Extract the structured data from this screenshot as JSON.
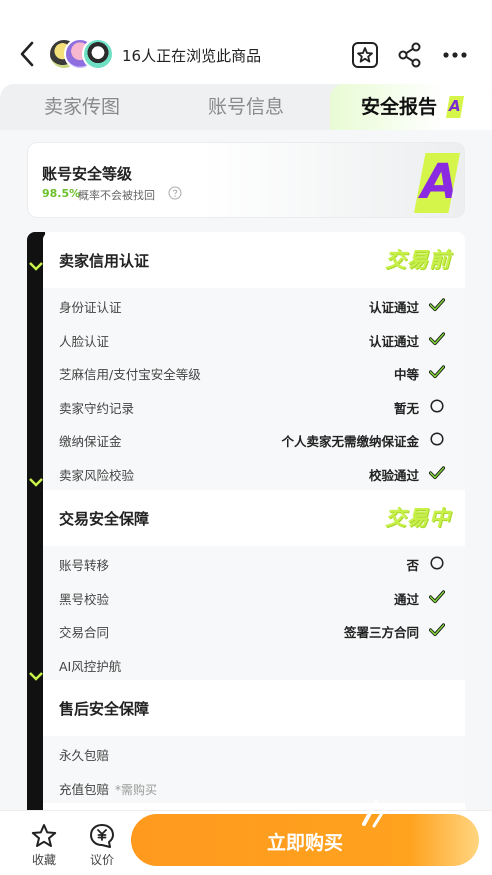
{
  "header": {
    "browsing_text": "16人正在浏览此商品"
  },
  "tabs": [
    {
      "label": "卖家传图"
    },
    {
      "label": "账号信息"
    },
    {
      "label": "安全报告",
      "badge": "A",
      "active": true
    }
  ],
  "security_level": {
    "title": "账号安全等级",
    "percent": "98.5%",
    "description": "概率不会被找回",
    "grade": "A"
  },
  "sections": [
    {
      "title": "卖家信用认证",
      "stamp": "交易前",
      "rows": [
        {
          "label": "身份证认证",
          "value": "认证通过",
          "status": "check"
        },
        {
          "label": "人脸认证",
          "value": "认证通过",
          "status": "check"
        },
        {
          "label": "芝麻信用/支付宝安全等级",
          "value": "中等",
          "status": "check"
        },
        {
          "label": "卖家守约记录",
          "value": "暂无",
          "status": "circle"
        },
        {
          "label": "缴纳保证金",
          "value": "个人卖家无需缴纳保证金",
          "status": "circle"
        },
        {
          "label": "卖家风险校验",
          "value": "校验通过",
          "status": "check"
        }
      ]
    },
    {
      "title": "交易安全保障",
      "stamp": "交易中",
      "rows": [
        {
          "label": "账号转移",
          "value": "否",
          "status": "circle"
        },
        {
          "label": "黑号校验",
          "value": "通过",
          "status": "check"
        },
        {
          "label": "交易合同",
          "value": "签署三方合同",
          "status": "check"
        },
        {
          "label": "AI风控护航",
          "value": "",
          "status": ""
        }
      ]
    },
    {
      "title": "售后安全保障",
      "stamp": "",
      "rows": [
        {
          "label": "永久包赔",
          "value": "",
          "status": ""
        },
        {
          "label": "充值包赔",
          "note": "*需购买",
          "value": "",
          "status": ""
        }
      ]
    }
  ],
  "bottom_bar": {
    "favorite_label": "收藏",
    "negotiate_label": "议价",
    "buy_label": "立即购买"
  },
  "colors": {
    "accent_green": "#d6f54a",
    "check_green": "#6cc02b",
    "buy_orange": "#ff9a1f",
    "grade_purple": "#8a2be2"
  }
}
